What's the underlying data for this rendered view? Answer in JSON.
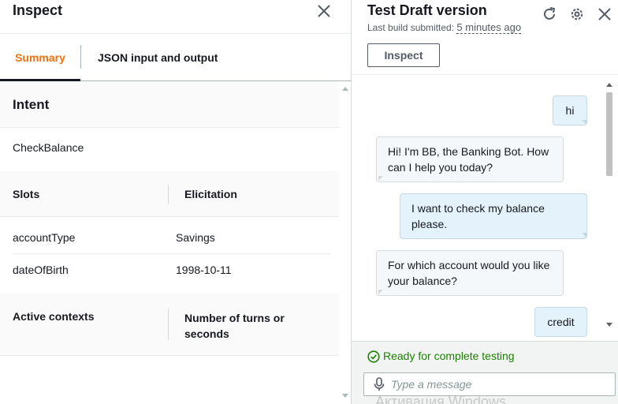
{
  "inspect": {
    "title": "Inspect",
    "tabs": [
      {
        "label": "Summary",
        "active": true
      },
      {
        "label": "JSON input and output",
        "active": false
      }
    ],
    "intent": {
      "heading": "Intent",
      "value": "CheckBalance"
    },
    "slots": {
      "headers": [
        "Slots",
        "Elicitation"
      ],
      "rows": [
        {
          "name": "accountType",
          "value": "Savings"
        },
        {
          "name": "dateOfBirth",
          "value": "1998-10-11"
        }
      ]
    },
    "contexts": {
      "headers": [
        "Active contexts",
        "Number of turns or seconds"
      ]
    }
  },
  "test": {
    "title": "Test Draft version",
    "build_label": "Last build submitted:",
    "build_time": "5 minutes ago",
    "inspect_button": "Inspect",
    "messages": [
      {
        "from": "user",
        "text": "hi"
      },
      {
        "from": "bot",
        "text": "Hi! I'm BB, the Banking Bot. How can I help you today?"
      },
      {
        "from": "user",
        "text": "I want to check my balance please."
      },
      {
        "from": "bot",
        "text": "For which account would you like your balance?"
      },
      {
        "from": "user",
        "text": "credit"
      }
    ],
    "status": "Ready for complete testing",
    "input_placeholder": "Type a message",
    "watermark": "Активация Windows"
  },
  "colors": {
    "accent": "#ec7211",
    "success": "#1d8102",
    "user_bubble": "#e4f2fb",
    "bot_bubble": "#f5f8fa"
  },
  "icons": [
    "close-icon",
    "refresh-icon",
    "settings-icon",
    "close-icon",
    "check-circle-icon",
    "microphone-icon"
  ]
}
